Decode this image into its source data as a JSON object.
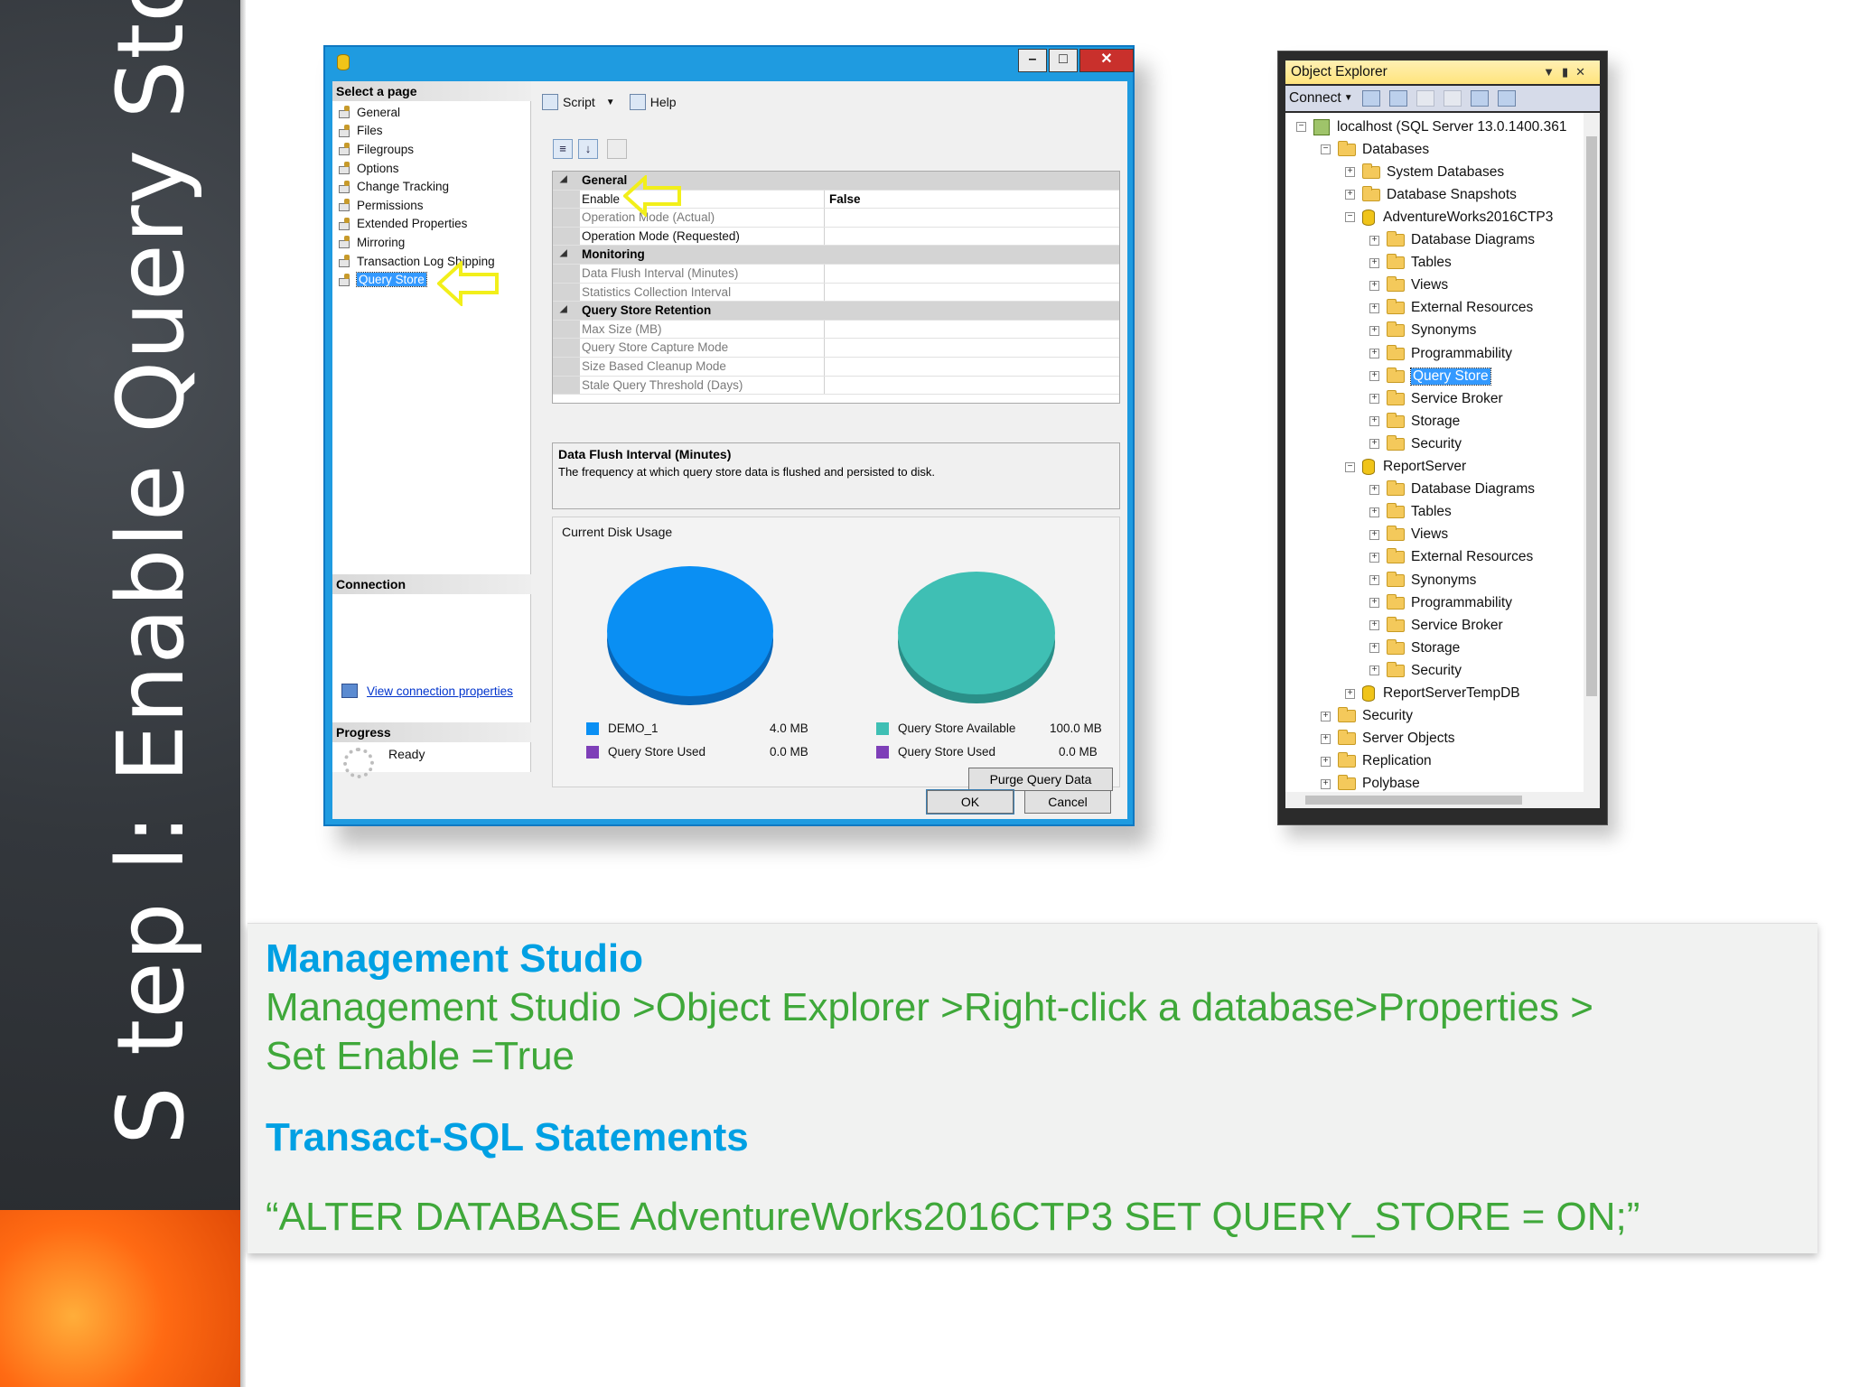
{
  "slide": {
    "step_title": "S tep l: Enable Query Store"
  },
  "dialog": {
    "left_panel": {
      "select_page_heading": "Select a page",
      "pages": [
        "General",
        "Files",
        "Filegroups",
        "Options",
        "Change Tracking",
        "Permissions",
        "Extended Properties",
        "Mirroring",
        "Transaction Log Shipping",
        "Query Store"
      ],
      "selected_page": "Query Store",
      "connection_heading": "Connection",
      "view_connection_link": "View connection properties",
      "progress_heading": "Progress",
      "progress_status": "Ready"
    },
    "toolbar": {
      "script_label": "Script",
      "help_label": "Help"
    },
    "property_grid": {
      "general": "General",
      "enable_label": "Enable",
      "enable_value": "False",
      "operation_mode_actual": "Operation Mode (Actual)",
      "operation_mode_requested": "Operation Mode (Requested)",
      "monitoring": "Monitoring",
      "data_flush_interval": "Data Flush Interval (Minutes)",
      "statistics_collection_interval": "Statistics Collection Interval",
      "retention": "Query Store Retention",
      "max_size": "Max Size (MB)",
      "capture_mode": "Query Store Capture Mode",
      "cleanup_mode": "Size Based Cleanup Mode",
      "stale_threshold": "Stale Query Threshold (Days)"
    },
    "description": {
      "title": "Data Flush Interval (Minutes)",
      "text": "The frequency at which query store data is flushed and persisted to disk."
    },
    "disk_usage": {
      "title": "Current Disk Usage",
      "left_legend": [
        {
          "label": "DEMO_1",
          "value": "4.0 MB"
        },
        {
          "label": "Query Store Used",
          "value": "0.0 MB"
        }
      ],
      "right_legend": [
        {
          "label": "Query Store Available",
          "value": "100.0 MB"
        },
        {
          "label": "Query Store Used",
          "value": "0.0 MB"
        }
      ],
      "purge_button": "Purge Query Data"
    },
    "buttons": {
      "ok": "OK",
      "cancel": "Cancel"
    },
    "colors": {
      "demo_1": "#0a8ff3",
      "query_store_used": "#7e3fb8",
      "query_store_available": "#3fbfb4"
    }
  },
  "object_explorer": {
    "title": "Object Explorer",
    "connect_label": "Connect",
    "tree": {
      "server": "localhost (SQL Server 13.0.1400.361",
      "databases": "Databases",
      "system_databases": "System Databases",
      "database_snapshots": "Database Snapshots",
      "adventureworks": "AdventureWorks2016CTP3",
      "aw_children": [
        "Database Diagrams",
        "Tables",
        "Views",
        "External Resources",
        "Synonyms",
        "Programmability",
        "Query Store",
        "Service Broker",
        "Storage",
        "Security"
      ],
      "reportserver": "ReportServer",
      "rs_children": [
        "Database Diagrams",
        "Tables",
        "Views",
        "External Resources",
        "Synonyms",
        "Programmability",
        "Service Broker",
        "Storage",
        "Security"
      ],
      "reportservertempdb": "ReportServerTempDB",
      "security": "Security",
      "server_objects": "Server Objects",
      "replication": "Replication",
      "polybase": "Polybase"
    }
  },
  "text_panel": {
    "heading1": "Management Studio",
    "line1": "Management Studio >Object Explorer >Right-click a database>Properties >",
    "line2": "Set Enable =True",
    "heading2": "Transact-SQL Statements",
    "sql": "“ALTER DATABASE AdventureWorks2016CTP3 SET QUERY_STORE = ON;”"
  }
}
